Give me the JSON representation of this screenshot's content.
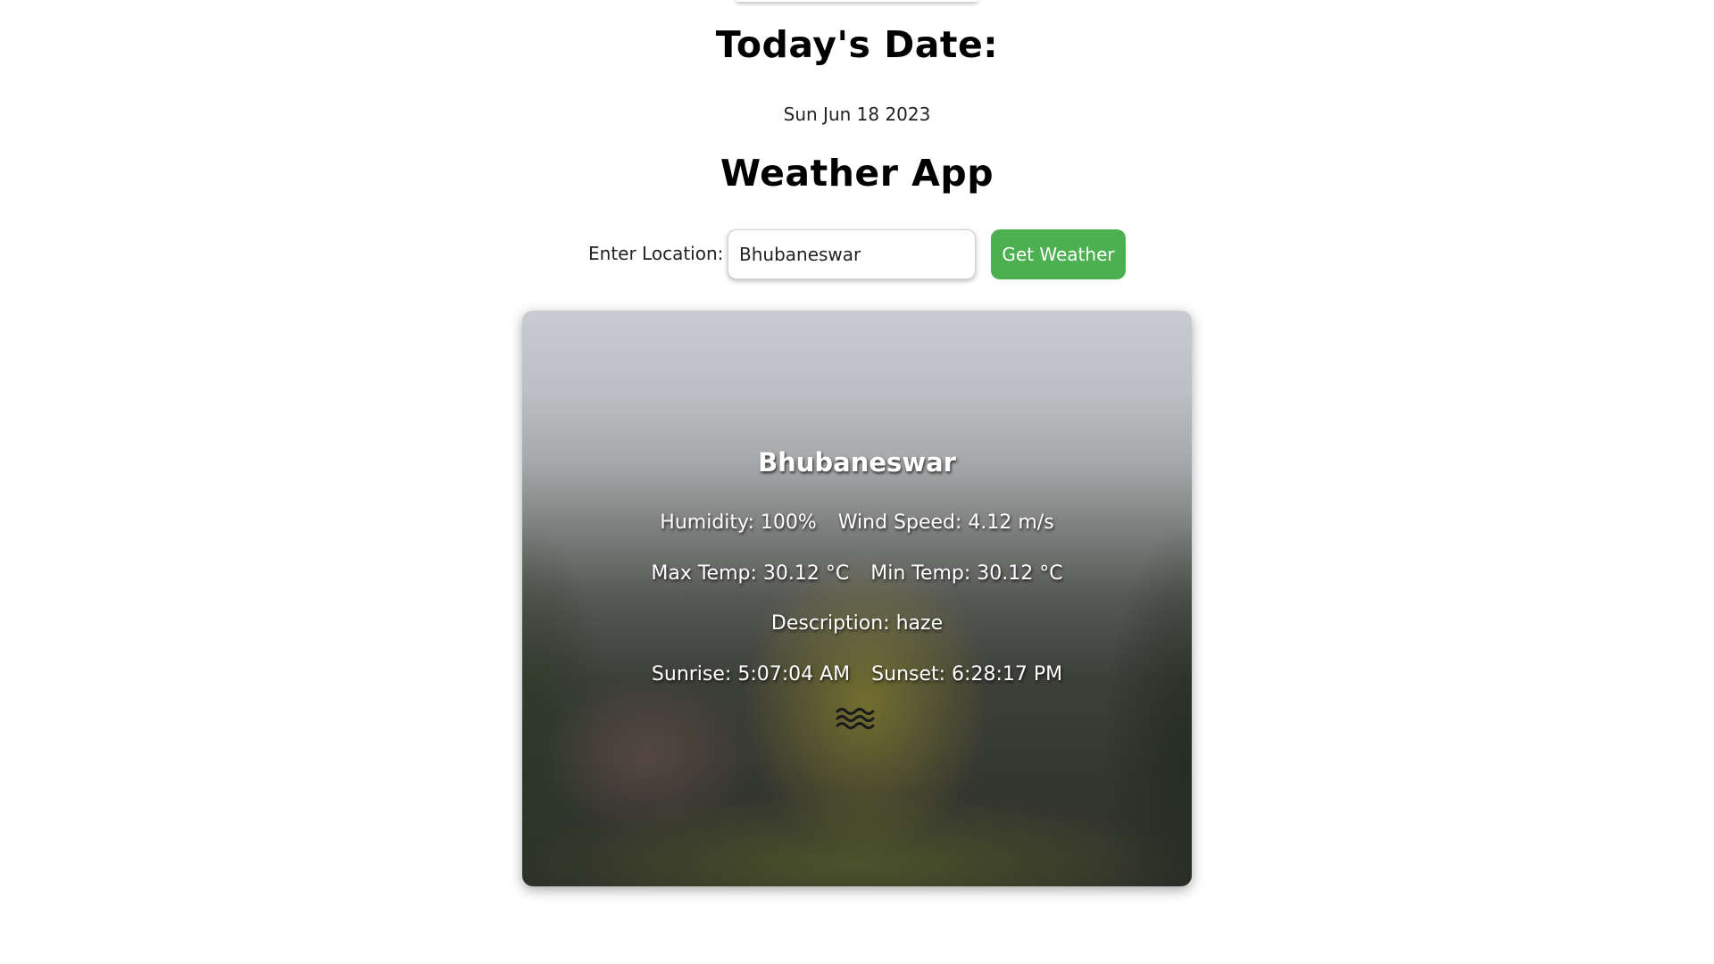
{
  "header": {
    "date_title": "Today's Date:",
    "date_value": "Sun Jun 18 2023",
    "app_title": "Weather App"
  },
  "search": {
    "label": "Enter Location:",
    "value": "Bhubaneswar",
    "button_label": "Get Weather"
  },
  "weather": {
    "city": "Bhubaneswar",
    "humidity": "Humidity: 100%",
    "wind_speed": "Wind Speed: 4.12 m/s",
    "max_temp": "Max Temp: 30.12 °C",
    "min_temp": "Min Temp: 30.12 °C",
    "description": "Description: haze",
    "sunrise": "Sunrise: 5:07:04 AM",
    "sunset": "Sunset: 6:28:17 PM",
    "icon": "haze-icon"
  },
  "colors": {
    "button_bg": "#4caf50",
    "button_text": "#ffffff",
    "card_text": "#ffffff"
  }
}
